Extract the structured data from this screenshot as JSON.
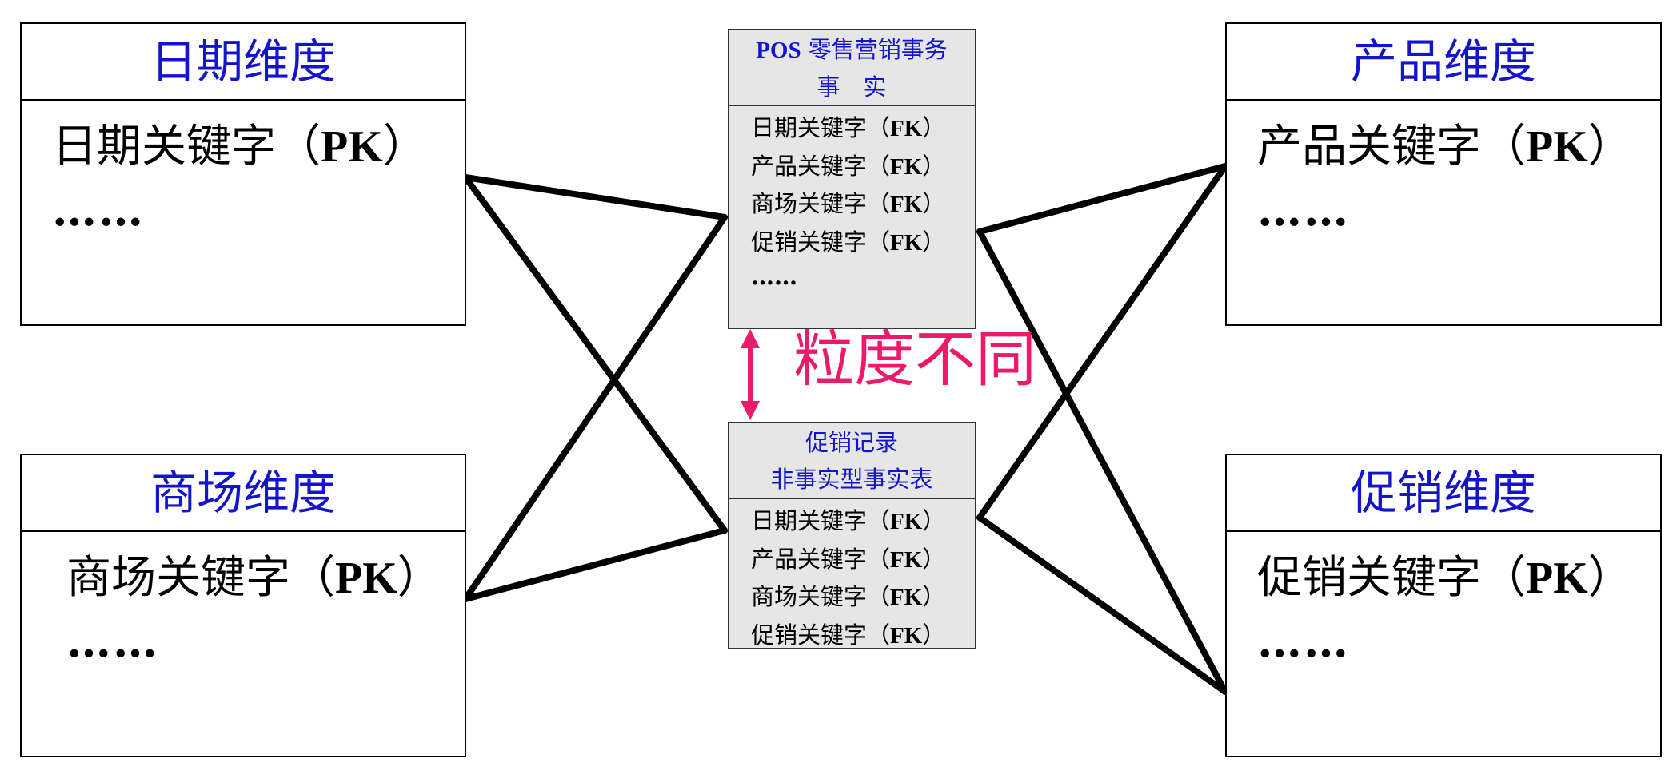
{
  "dimensions": {
    "date": {
      "title": "日期维度",
      "key_prefix": "日期关键字（",
      "key_code": "PK",
      "key_suffix": "）",
      "more": "……"
    },
    "store": {
      "title": "商场维度",
      "key_prefix": "商场关键字（",
      "key_code": "PK",
      "key_suffix": "）",
      "more": "……"
    },
    "product": {
      "title": "产品维度",
      "key_prefix": "产品关键字（",
      "key_code": "PK",
      "key_suffix": "）",
      "more": "……"
    },
    "promotion": {
      "title": "促销维度",
      "key_prefix": "促销关键字（",
      "key_code": "PK",
      "key_suffix": "）",
      "more": "……"
    }
  },
  "fact_pos": {
    "title_line1_prefix": "POS",
    "title_line1_rest": " 零售营销事务",
    "title_line2": "事　实",
    "rows": [
      {
        "label": "日期关键字（",
        "code": "FK",
        "close": "）"
      },
      {
        "label": "产品关键字（",
        "code": "FK",
        "close": "）"
      },
      {
        "label": "商场关键字（",
        "code": "FK",
        "close": "）"
      },
      {
        "label": "促销关键字（",
        "code": "FK",
        "close": "）"
      }
    ],
    "more": "……"
  },
  "fact_promo": {
    "title_line1": "促销记录",
    "title_line2": "非事实型事实表",
    "rows": [
      {
        "label": "日期关键字（",
        "code": "FK",
        "close": "）"
      },
      {
        "label": "产品关键字（",
        "code": "FK",
        "close": "）"
      },
      {
        "label": "商场关键字（",
        "code": "FK",
        "close": "）"
      },
      {
        "label": "促销关键字（",
        "code": "FK",
        "close": "）"
      }
    ]
  },
  "granularity_label": "粒度不同",
  "colors": {
    "header_blue": "#1414cc",
    "accent_pink": "#ec1a6b",
    "fact_fill": "#e6e6e6",
    "line": "#000000"
  }
}
